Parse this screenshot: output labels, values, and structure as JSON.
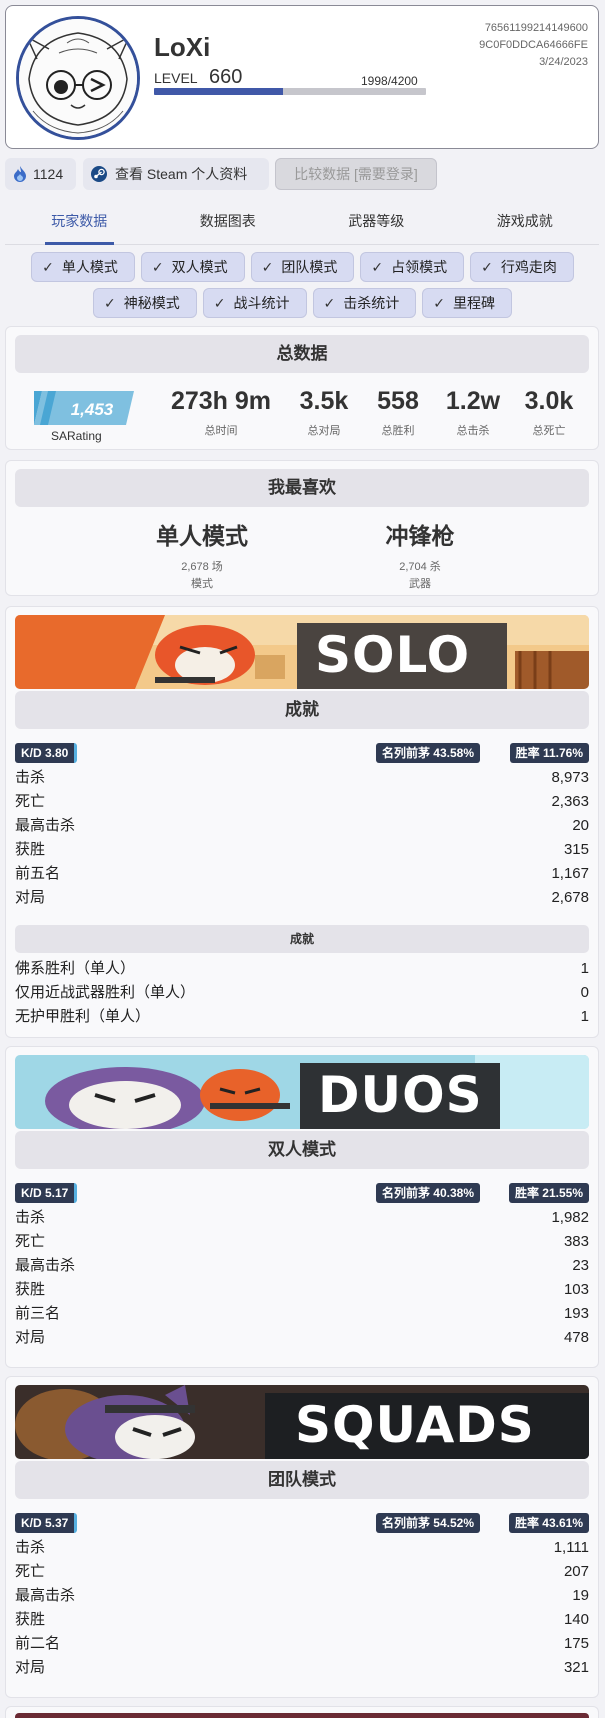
{
  "profile": {
    "name": "LoXi",
    "level_label": "LEVEL",
    "level": "660",
    "xp_text": "1998/4200",
    "xp_progress": 0.476,
    "steam_id": "76561199214149600",
    "hash": "9C0F0DDCA64666FE",
    "date": "3/24/2023"
  },
  "actions": {
    "coins": "1124",
    "steam_profile": "查看 Steam 个人资料",
    "compare": "比较数据 [需要登录]"
  },
  "tabs": [
    "玩家数据",
    "数据图表",
    "武器等级",
    "游戏成就"
  ],
  "filters_row1": [
    "单人模式",
    "双人模式",
    "团队模式",
    "占领模式",
    "行鸡走肉"
  ],
  "filters_row2": [
    "神秘模式",
    "战斗统计",
    "击杀统计",
    "里程碑"
  ],
  "totals": {
    "title": "总数据",
    "sarating_value": "1,453",
    "sarating_label": "SARating",
    "time": "273h 9m",
    "time_label": "总时间",
    "games": "3.5k",
    "games_label": "总对局",
    "wins": "558",
    "wins_label": "总胜利",
    "kills": "1.2w",
    "kills_label": "总击杀",
    "deaths": "3.0k",
    "deaths_label": "总死亡"
  },
  "favorites": {
    "title": "我最喜欢",
    "mode": "单人模式",
    "mode_count": "2,678 场",
    "mode_label": "模式",
    "weapon": "冲锋枪",
    "weapon_count": "2,704 杀",
    "weapon_label": "武器"
  },
  "solo": {
    "banner": "SOLO",
    "title": "成就",
    "kd": "K/D  3.80",
    "top": "名列前茅 43.58%",
    "winrate": "胜率 11.76%",
    "rows": [
      {
        "label": "击杀",
        "value": "8,973"
      },
      {
        "label": "死亡",
        "value": "2,363"
      },
      {
        "label": "最高击杀",
        "value": "20"
      },
      {
        "label": "获胜",
        "value": "315"
      },
      {
        "label": "前五名",
        "value": "1,167"
      },
      {
        "label": "对局",
        "value": "2,678"
      }
    ],
    "sub_title": "成就",
    "sub_rows": [
      {
        "label": "佛系胜利（单人）",
        "value": "1"
      },
      {
        "label": "仅用近战武器胜利（单人）",
        "value": "0"
      },
      {
        "label": "无护甲胜利（单人）",
        "value": "1"
      }
    ]
  },
  "duos": {
    "banner": "DUOS",
    "title": "双人模式",
    "kd": "K/D  5.17",
    "top": "名列前茅 40.38%",
    "winrate": "胜率 21.55%",
    "rows": [
      {
        "label": "击杀",
        "value": "1,982"
      },
      {
        "label": "死亡",
        "value": "383"
      },
      {
        "label": "最高击杀",
        "value": "23"
      },
      {
        "label": "获胜",
        "value": "103"
      },
      {
        "label": "前三名",
        "value": "193"
      },
      {
        "label": "对局",
        "value": "478"
      }
    ]
  },
  "squads": {
    "banner": "SQUADS",
    "title": "团队模式",
    "kd": "K/D  5.37",
    "top": "名列前茅 54.52%",
    "winrate": "胜率 43.61%",
    "rows": [
      {
        "label": "击杀",
        "value": "1,111"
      },
      {
        "label": "死亡",
        "value": "207"
      },
      {
        "label": "最高击杀",
        "value": "19"
      },
      {
        "label": "获胜",
        "value": "140"
      },
      {
        "label": "前二名",
        "value": "175"
      },
      {
        "label": "对局",
        "value": "321"
      }
    ]
  }
}
